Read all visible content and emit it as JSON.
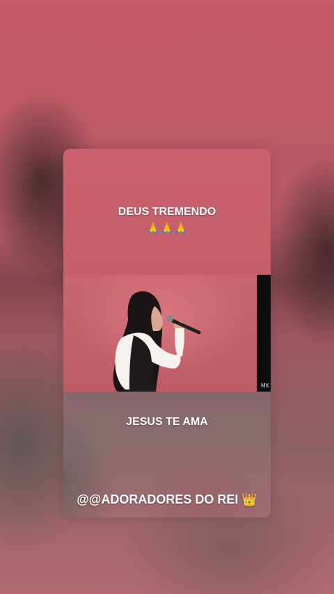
{
  "story": {
    "top_caption": "DEUS TREMENDO",
    "top_emojis": "🙏🙏🙏",
    "middle_caption": "JESUS TE AMA",
    "bottom_caption": "@@ADORADORES DO REI",
    "bottom_emoji": "👑",
    "video_watermark": "MK"
  },
  "colors": {
    "card_top": "#c95f6b",
    "background": "#b9616a"
  }
}
